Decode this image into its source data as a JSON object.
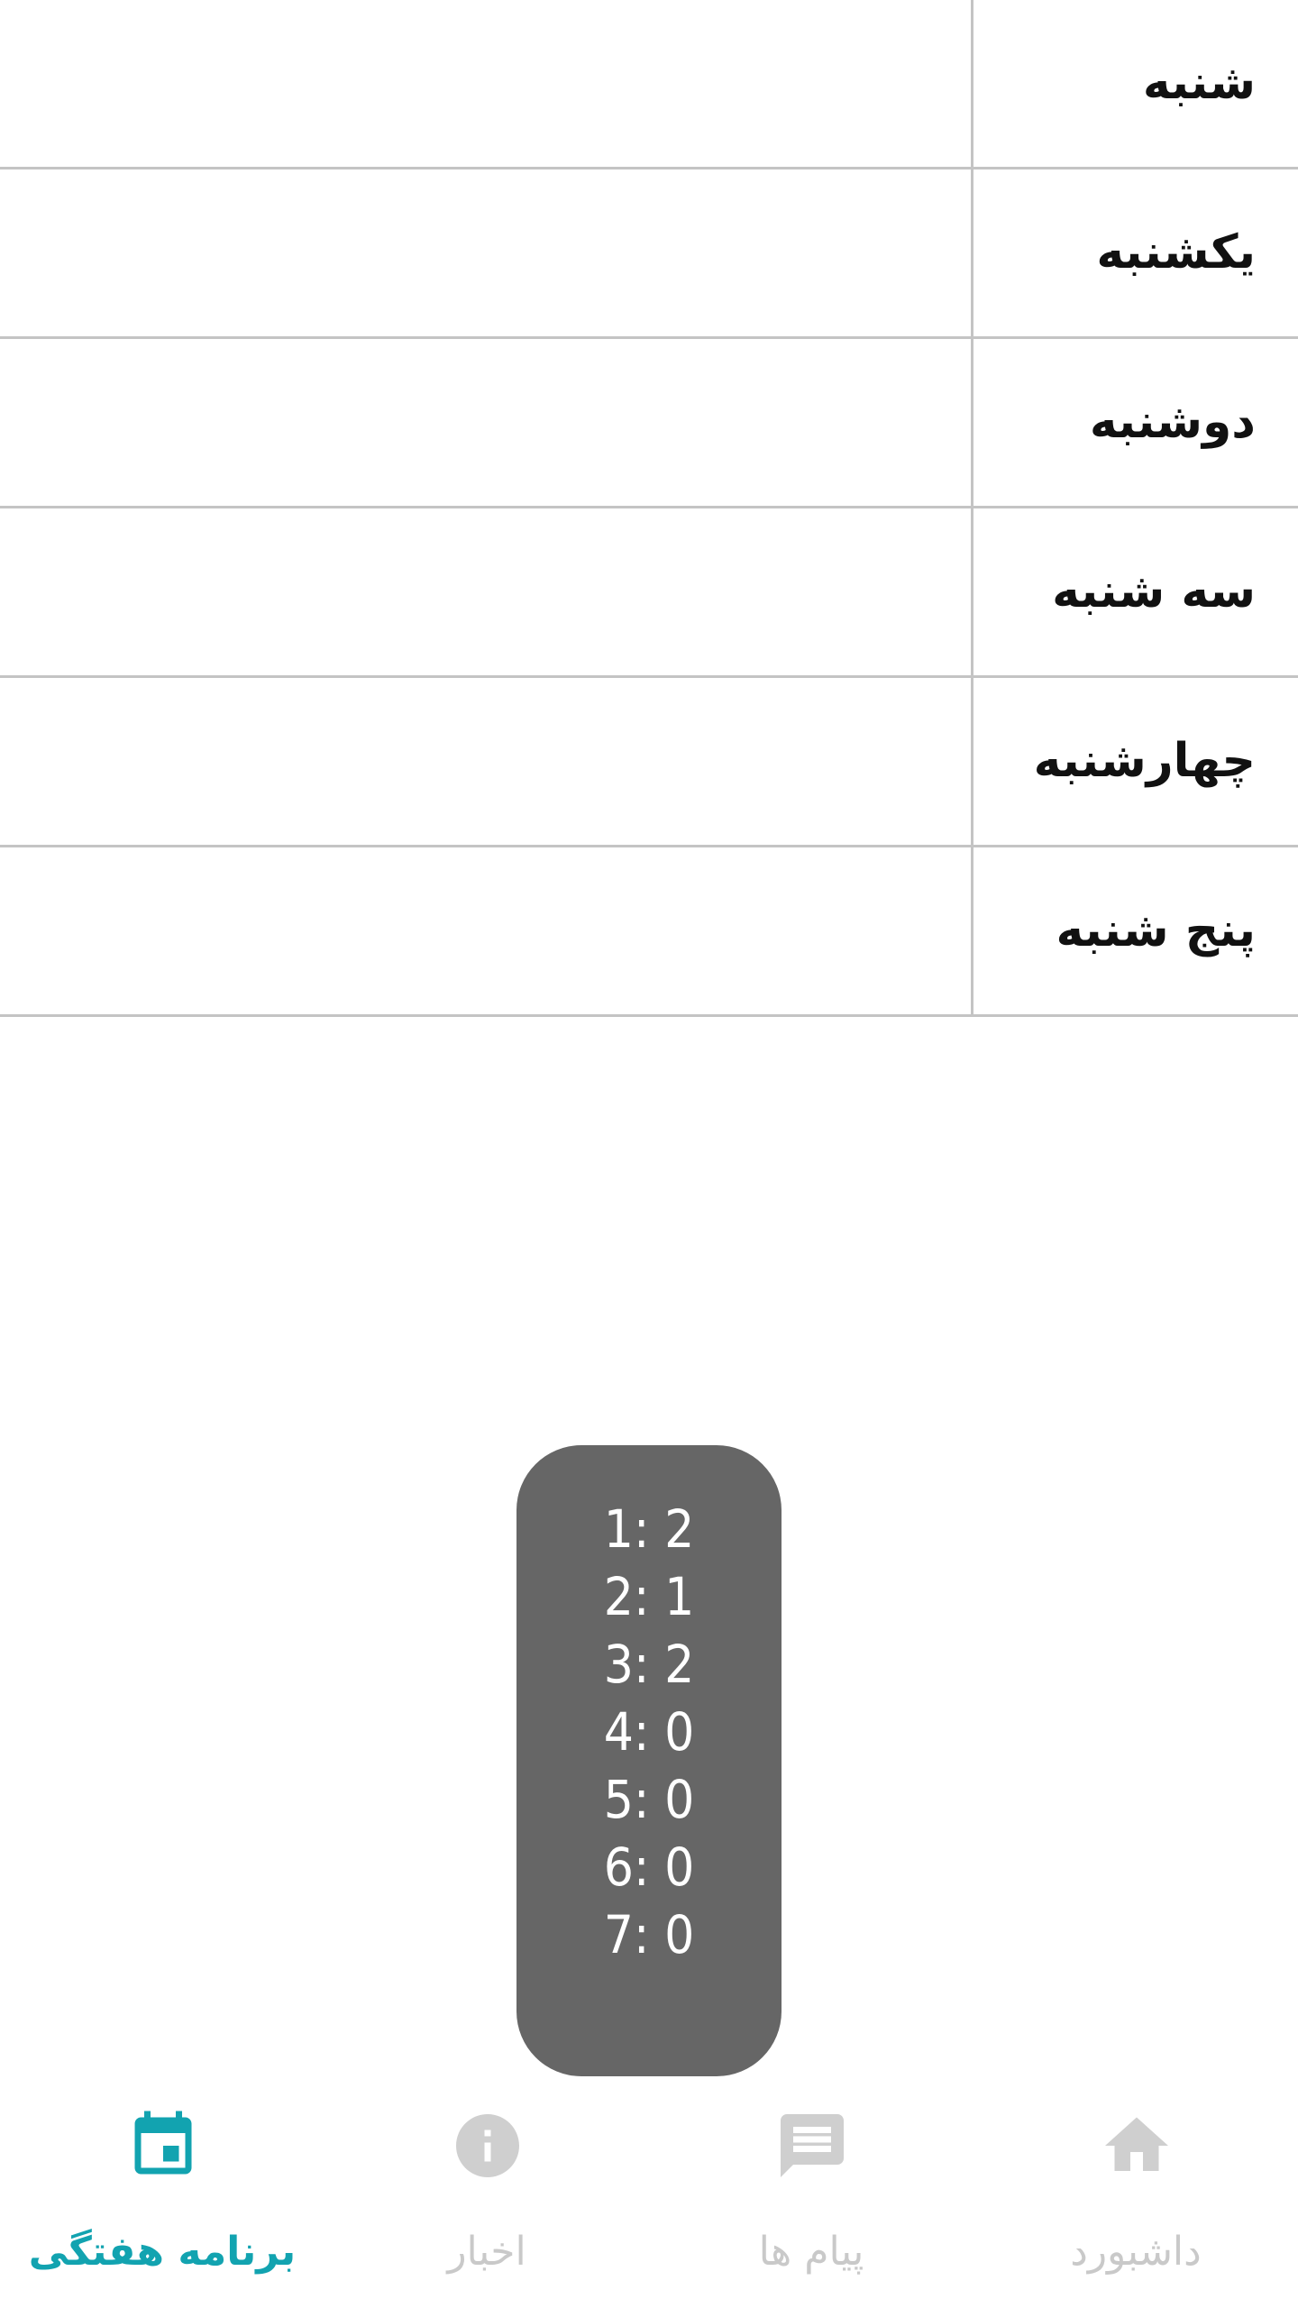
{
  "schedule": {
    "days": [
      {
        "label": "شنبه"
      },
      {
        "label": "یکشنبه"
      },
      {
        "label": "دوشنبه"
      },
      {
        "label": "سه شنبه"
      },
      {
        "label": "چهارشنبه"
      },
      {
        "label": "پنج شنبه"
      }
    ]
  },
  "toast": {
    "lines": [
      "1: 2",
      "2: 1",
      "3: 2",
      "4: 0",
      "5: 0",
      "6: 0",
      "7: 0"
    ]
  },
  "bottom_nav": {
    "active_color": "#12a3b0",
    "inactive_color": "#c9c9c9",
    "items": [
      {
        "label": "برنامه هفتگی",
        "icon": "calendar-icon",
        "active": true
      },
      {
        "label": "اخبار",
        "icon": "info-icon",
        "active": false
      },
      {
        "label": "پیام ها",
        "icon": "message-icon",
        "active": false
      },
      {
        "label": "داشبورد",
        "icon": "home-icon",
        "active": false
      }
    ]
  }
}
